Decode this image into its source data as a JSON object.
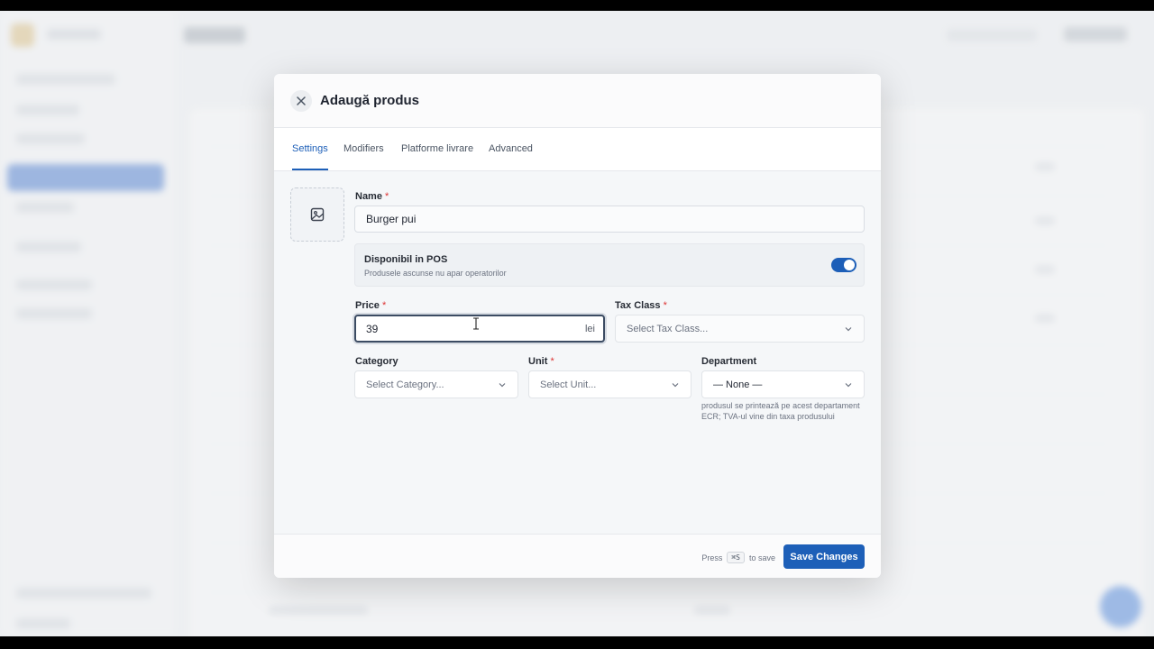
{
  "modal": {
    "title": "Adaugă produs",
    "tabs": [
      {
        "label": "Settings",
        "active": true
      },
      {
        "label": "Modifiers",
        "active": false
      },
      {
        "label": "Platforme livrare",
        "active": false
      },
      {
        "label": "Advanced",
        "active": false
      }
    ],
    "fields": {
      "name": {
        "label": "Name",
        "required_mark": "*",
        "value": "Burger pui"
      },
      "pos_available": {
        "title": "Disponibil in POS",
        "subtitle": "Produsele ascunse nu apar operatorilor",
        "enabled": true
      },
      "price": {
        "label": "Price",
        "required_mark": "*",
        "value": "39",
        "suffix": "lei"
      },
      "tax_class": {
        "label": "Tax Class",
        "required_mark": "*",
        "placeholder": "Select Tax Class..."
      },
      "category": {
        "label": "Category",
        "placeholder": "Select Category..."
      },
      "unit": {
        "label": "Unit",
        "required_mark": "*",
        "placeholder": "Select Unit..."
      },
      "department": {
        "label": "Department",
        "value": "— None —",
        "helper": "produsul se printează pe acest departament ECR; TVA-ul vine din taxa produsului"
      }
    },
    "footer": {
      "hint_prefix": "Press",
      "hint_key": "⌘S",
      "hint_suffix": "to save",
      "save_label": "Save Changes"
    }
  },
  "colors": {
    "accent": "#1d5fb8",
    "required": "#dd3333"
  }
}
